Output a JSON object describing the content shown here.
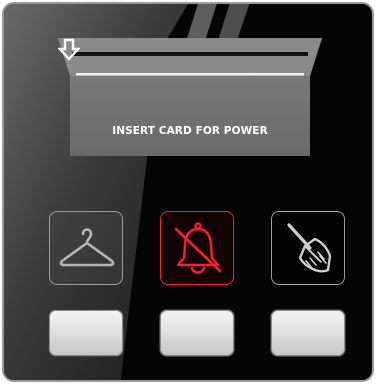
{
  "card_slot": {
    "label": "INSERT CARD FOR POWER",
    "arrow_icon": "arrow-down-icon"
  },
  "service_icons": [
    {
      "name": "laundry",
      "icon": "hanger-icon",
      "color": "#b5b5b5"
    },
    {
      "name": "do-not-disturb",
      "icon": "bell-slash-icon",
      "color": "#ff1d2b"
    },
    {
      "name": "make-up-room",
      "icon": "broom-icon",
      "color": "#cfcfcf"
    }
  ],
  "colors": {
    "panel": "#050505",
    "frame": "#9a9a9a",
    "dnd_red": "#ff1d2b"
  }
}
